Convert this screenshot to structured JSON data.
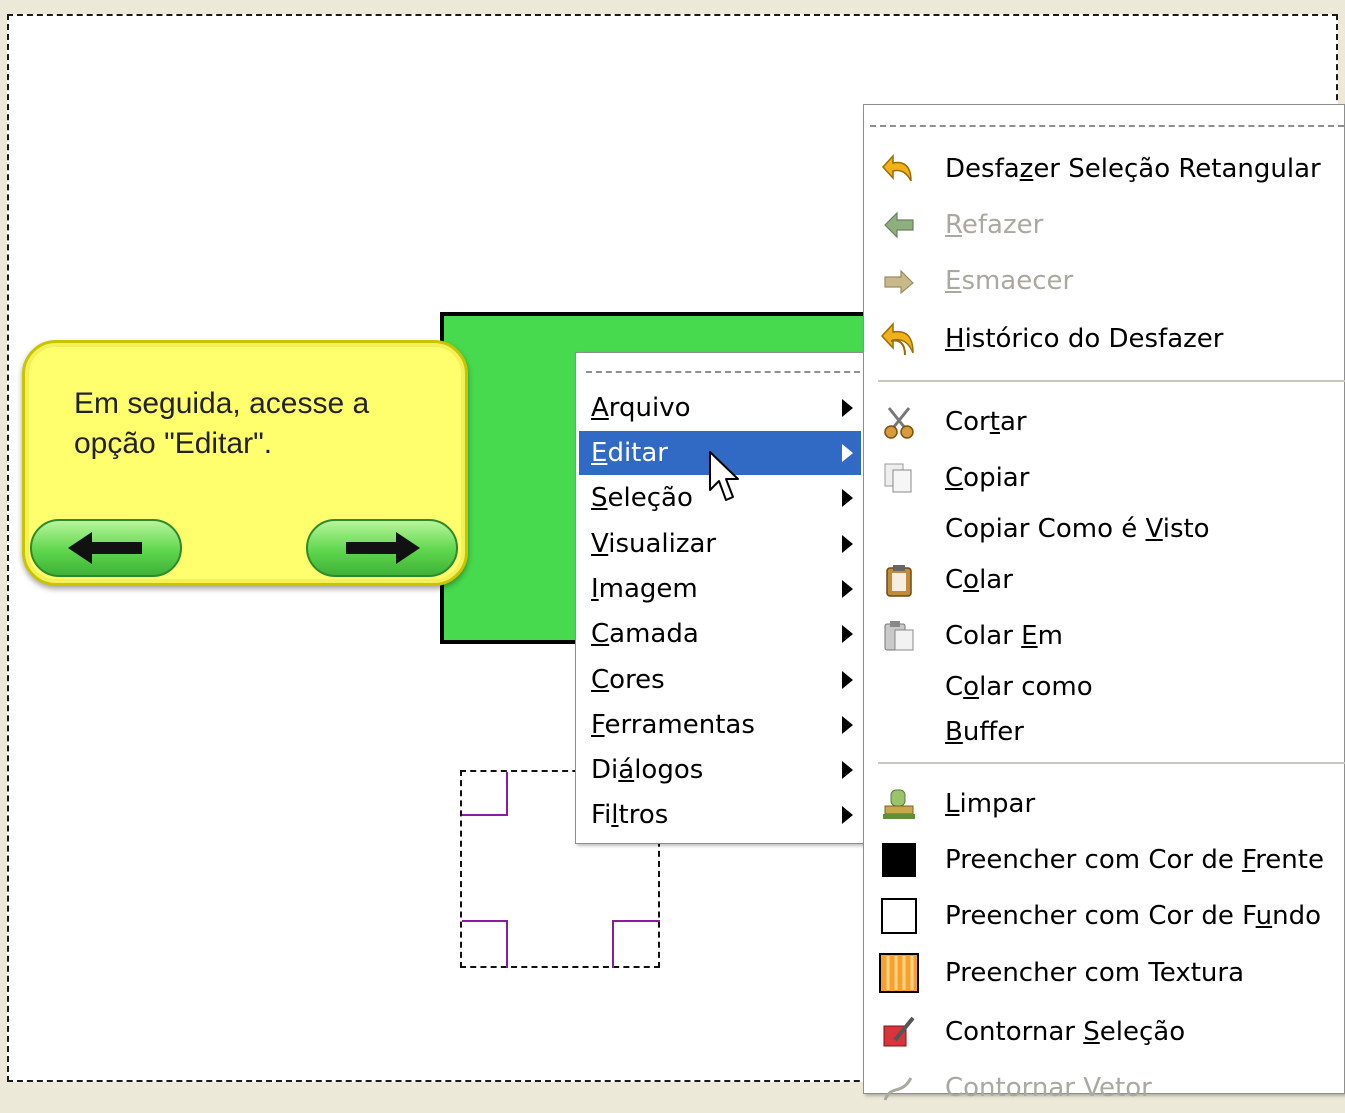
{
  "tooltip": {
    "text_line1": "Em seguida, acesse a",
    "text_line2": "opção \"Editar\".",
    "back_icon": "arrow-left-icon",
    "next_icon": "arrow-right-icon"
  },
  "context_menu": {
    "items": [
      {
        "label": "Arquivo",
        "mnemonic": "A",
        "rest": "rquivo"
      },
      {
        "label": "Editar",
        "mnemonic": "E",
        "rest": "ditar",
        "selected": true
      },
      {
        "label": "Seleção",
        "mnemonic": "S",
        "rest": "eleção"
      },
      {
        "label": "Visualizar",
        "mnemonic": "V",
        "rest": "isualizar"
      },
      {
        "label": "Imagem",
        "mnemonic": "I",
        "rest": "magem"
      },
      {
        "label": "Camada",
        "mnemonic": "C",
        "rest": "amada"
      },
      {
        "label": "Cores",
        "mnemonic": "C",
        "rest": "ores"
      },
      {
        "label": "Ferramentas",
        "mnemonic": "F",
        "rest": "erramentas"
      },
      {
        "label": "Diálogos",
        "pre": "Di",
        "mnemonic": "á",
        "rest": "logos"
      },
      {
        "label": "Filtros",
        "pre": "Fi",
        "mnemonic": "l",
        "rest": "tros"
      }
    ]
  },
  "edit_menu": {
    "items": [
      {
        "pre": "Desfa",
        "u": "z",
        "post": "er Seleção Retangular",
        "icon": "undo-icon",
        "disabled": false
      },
      {
        "pre": "",
        "u": "R",
        "post": "efazer",
        "icon": "redo-icon",
        "disabled": true
      },
      {
        "pre": "",
        "u": "E",
        "post": "smaecer",
        "icon": "fade-icon",
        "disabled": true
      },
      {
        "pre": "",
        "u": "H",
        "post": "istórico do Desfazer",
        "icon": "undo-history-icon",
        "disabled": false
      },
      {
        "pre": "Cor",
        "u": "t",
        "post": "ar",
        "icon": "scissors-icon",
        "disabled": false
      },
      {
        "pre": "",
        "u": "C",
        "post": "opiar",
        "icon": "copy-icon",
        "disabled": false
      },
      {
        "pre": "Copiar Como é ",
        "u": "V",
        "post": "isto",
        "icon": "",
        "disabled": false
      },
      {
        "pre": "C",
        "u": "o",
        "post": "lar",
        "icon": "paste-icon",
        "disabled": false
      },
      {
        "pre": "Colar ",
        "u": "E",
        "post": "m",
        "icon": "paste-into-icon",
        "disabled": false
      },
      {
        "pre": "C",
        "u": "o",
        "post": "lar como",
        "icon": "",
        "disabled": false
      },
      {
        "pre": "",
        "u": "B",
        "post": "uffer",
        "icon": "",
        "disabled": false
      },
      {
        "pre": "",
        "u": "L",
        "post": "impar",
        "icon": "clear-icon",
        "disabled": false
      },
      {
        "pre": "Preencher com Cor de ",
        "u": "F",
        "post": "rente",
        "icon": "fg-color-swatch-icon",
        "disabled": false
      },
      {
        "pre": "Preencher com Cor de F",
        "u": "u",
        "post": "ndo",
        "icon": "bg-color-swatch-icon",
        "disabled": false
      },
      {
        "pre": "Preencher com Textura",
        "u": "",
        "post": "",
        "icon": "pattern-swatch-icon",
        "disabled": false
      },
      {
        "pre": "Contornar ",
        "u": "S",
        "post": "eleção",
        "icon": "stroke-selection-icon",
        "disabled": false
      },
      {
        "pre": "Contornar Vetor",
        "u": "",
        "post": "",
        "icon": "stroke-path-icon",
        "disabled": true
      }
    ]
  },
  "colors": {
    "canvas_bg": "#ffffff",
    "green_layer": "#47d94e",
    "menu_highlight": "#316ac5",
    "tooltip_bg": "#ffff6e"
  }
}
